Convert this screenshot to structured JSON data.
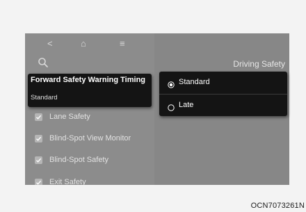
{
  "nav": {
    "back": "<",
    "home": "⌂",
    "menu": "≡"
  },
  "sidebar": {
    "selected": {
      "title": "Forward Safety Warning Timing",
      "value": "Standard"
    },
    "items": [
      {
        "label": "Lane Safety",
        "checked": true
      },
      {
        "label": "Blind-Spot View Monitor",
        "checked": true
      },
      {
        "label": "Blind-Spot Safety",
        "checked": true
      },
      {
        "label": "Exit Safety",
        "checked": true
      }
    ]
  },
  "main": {
    "title": "Driving Safety",
    "options": [
      {
        "label": "Standard",
        "selected": true
      },
      {
        "label": "Late",
        "selected": false
      }
    ]
  },
  "caption": "OCN7073261N",
  "colors": {
    "screen_bg": "#8a8a8a",
    "popup_bg": "#141414",
    "text_light": "#ffffff"
  }
}
